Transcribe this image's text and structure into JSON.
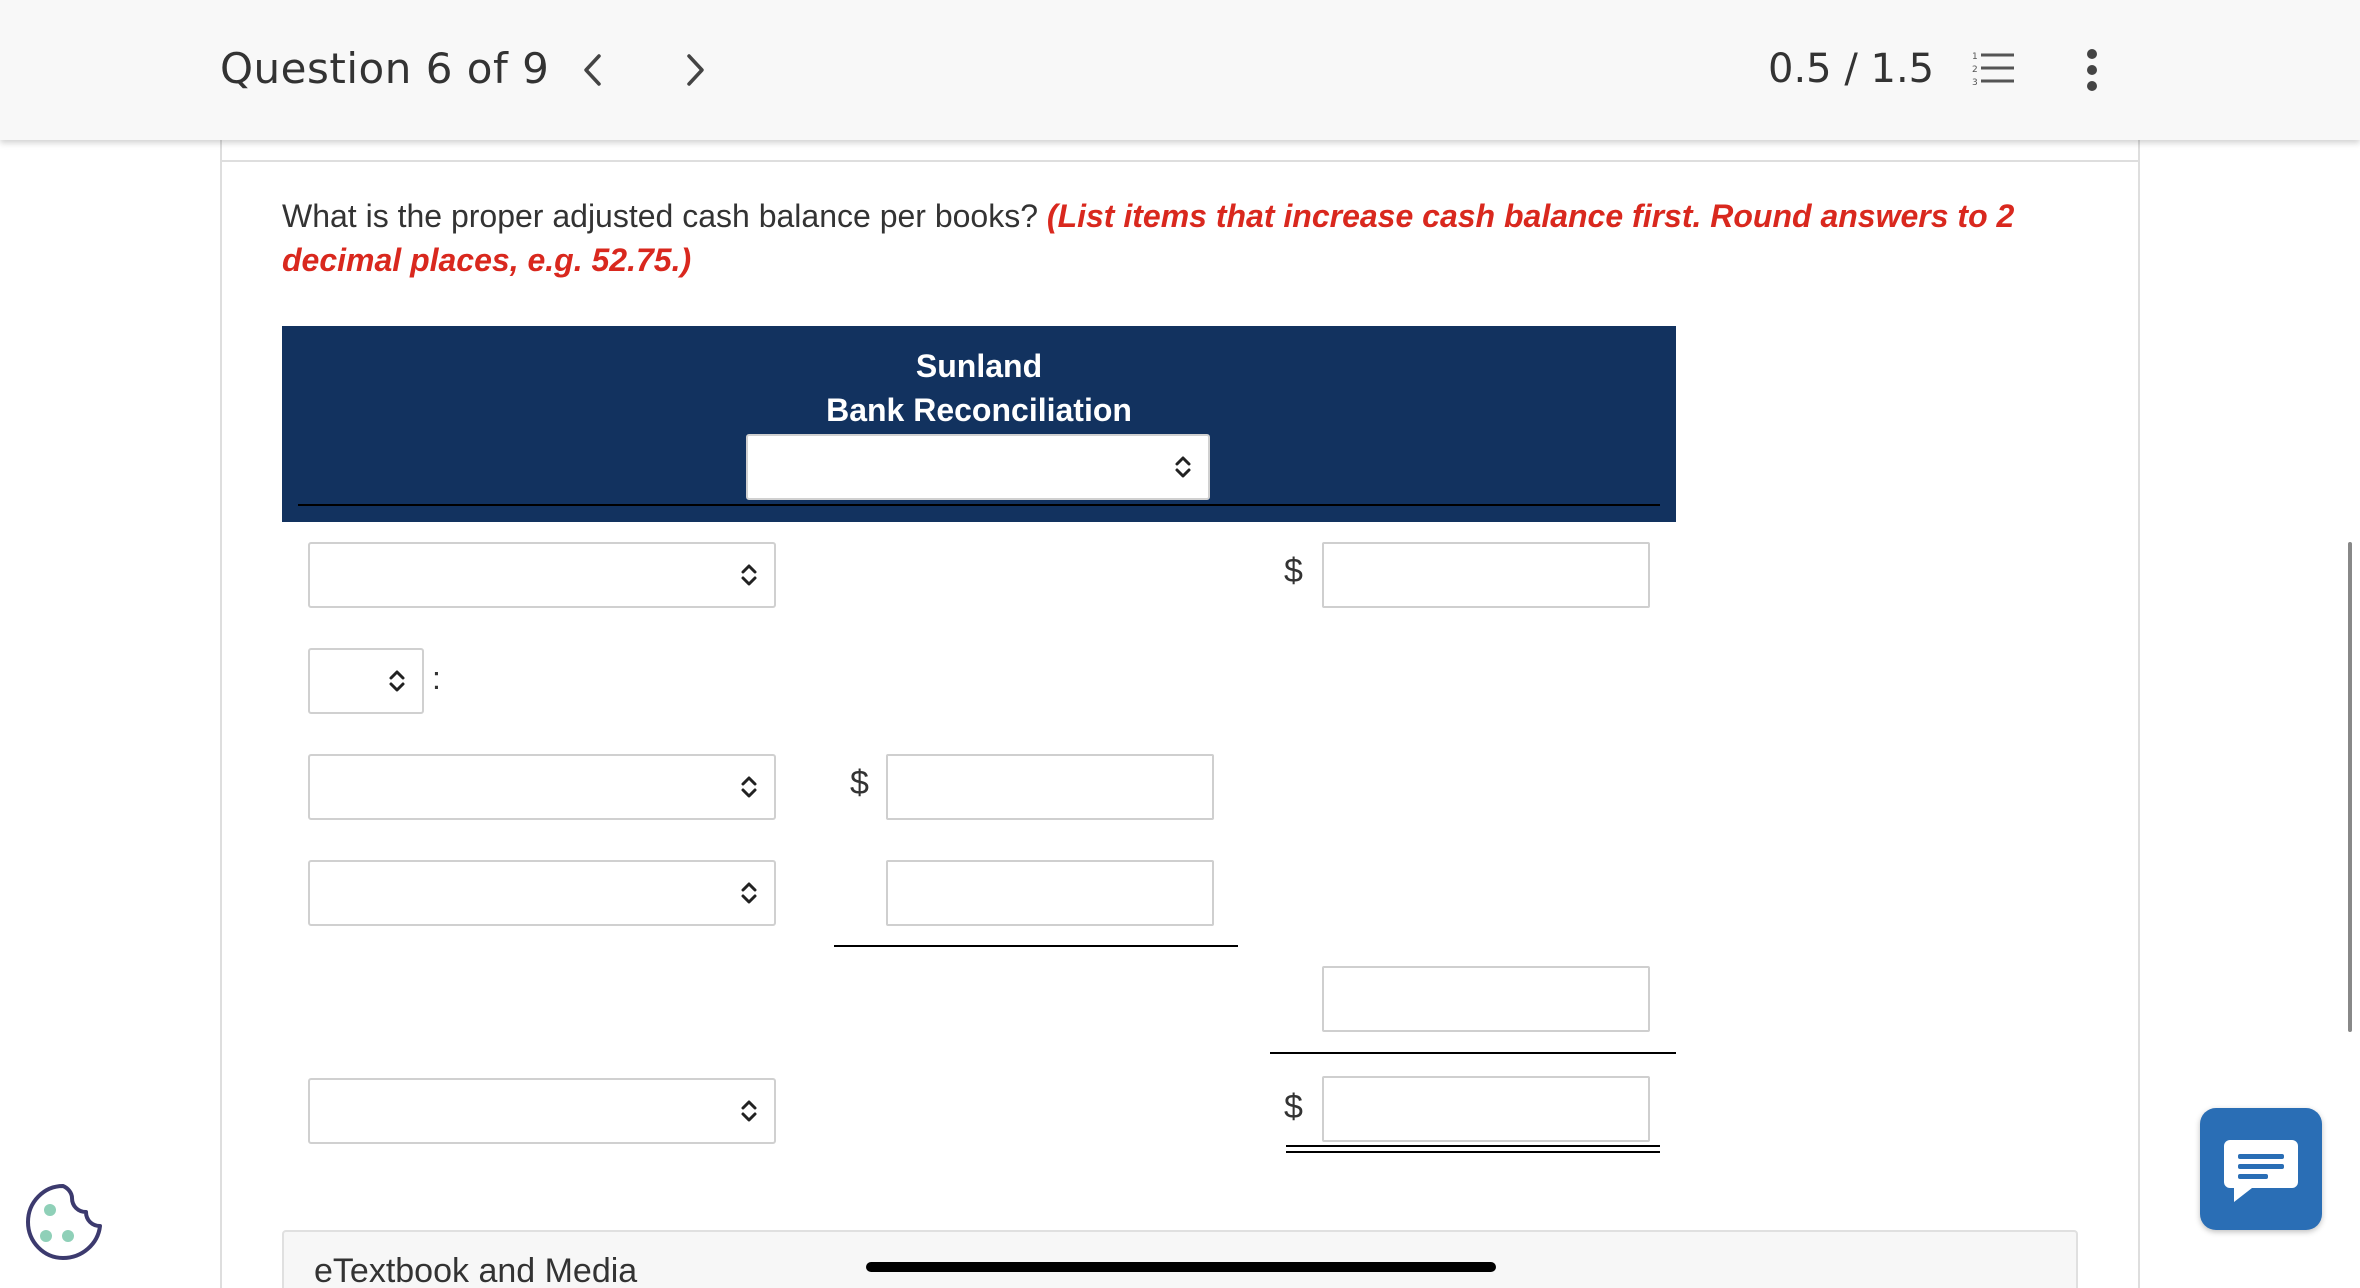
{
  "header": {
    "question_label": "Question 6 of 9",
    "prev_icon": "chevron-left-icon",
    "next_icon": "chevron-right-icon",
    "score": "0.5 / 1.5",
    "list_icon": "numbered-list-icon",
    "more_icon": "more-vertical-icon"
  },
  "question": {
    "text": "What is the proper adjusted cash balance per books? ",
    "hint": "(List items that increase cash balance first. Round answers to 2 decimal places, e.g. 52.75.)"
  },
  "reconciliation": {
    "company": "Sunland",
    "title": "Bank Reconciliation",
    "date_select": {
      "value": ""
    }
  },
  "rows": {
    "row1_select": "",
    "row1_currency": "$",
    "row1_amount": "",
    "add_select": "",
    "add_colon": ":",
    "row3_select": "",
    "row3_currency": "$",
    "row3_amount": "",
    "row4_select": "",
    "row4_amount": "",
    "subtotal_amount": "",
    "row6_select": "",
    "total_currency": "$",
    "total_amount": ""
  },
  "footer": {
    "etextbook_label": "eTextbook and Media"
  },
  "colors": {
    "header_bg": "#12325f",
    "hint": "#d9281e",
    "chat_button": "#2a6eb5",
    "cookie_icon": "#3c3a6e"
  },
  "icons": {
    "chat": "chat-bubble-icon",
    "cookie": "cookie-icon",
    "select_chevron": "chevron-up-down-icon"
  }
}
